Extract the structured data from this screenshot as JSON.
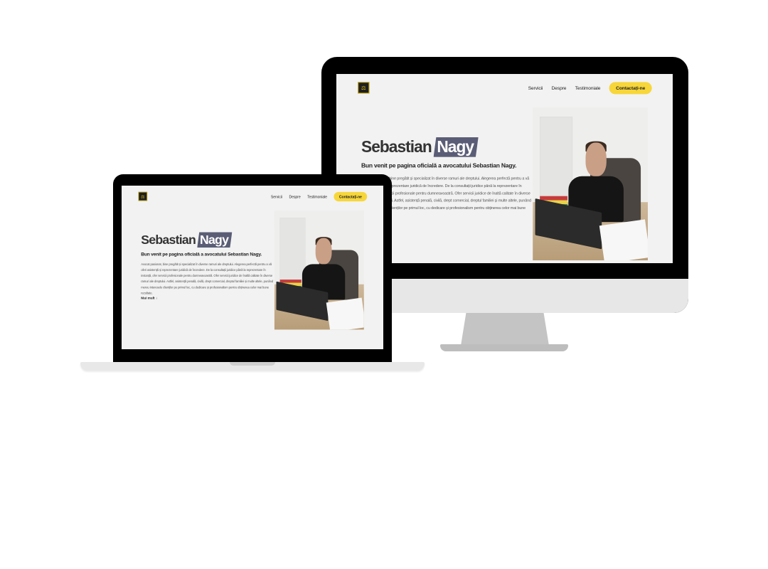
{
  "site": {
    "logo_glyph": "⚖",
    "nav": {
      "items": [
        "Servicii",
        "Despre",
        "Testimoniale"
      ],
      "cta": "Contactați-ne"
    },
    "hero": {
      "first_name": "Sebastian",
      "last_name": "Nagy",
      "subtitle": "Bun venit pe pagina oficială a avocatului Sebastian Nagy.",
      "bio": "Avocat pasionat, bine pregătit și specializat în diverse ramuri ale dreptului. Alegerea perfectă pentru a vă oferi asistență și reprezentare juridică de încredere. De la consultații juridice până la reprezentare în instanță, ofer servicii profesionale pentru dumneavoastră. Ofer servicii juridice de înaltă calitate în diverse ramuri ale dreptului. Astfel, asistență penală, civilă, drept comercial, dreptul familiei și multe altele, punând mereu interesele clienților pe primul loc, cu dedicare și profesionalism pentru obținerea celor mai bune rezultate.",
      "more_label": "Mai mult ↓"
    },
    "accent_color": "#f7d63a",
    "highlight_color": "#5a5d75"
  }
}
